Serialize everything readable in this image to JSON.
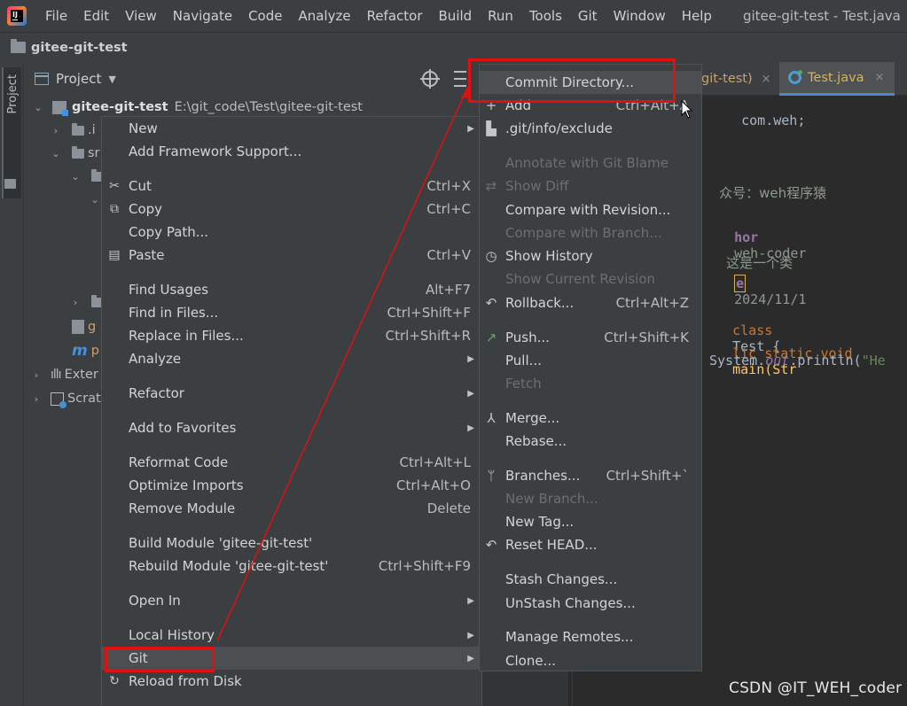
{
  "menubar": {
    "items": [
      "File",
      "Edit",
      "View",
      "Navigate",
      "Code",
      "Analyze",
      "Refactor",
      "Build",
      "Run",
      "Tools",
      "Git",
      "Window",
      "Help"
    ],
    "window_title": "gitee-git-test - Test.java"
  },
  "project_bar": {
    "name": "gitee-git-test"
  },
  "side_strip": {
    "tab_label": "Project"
  },
  "project_panel": {
    "view_label": "Project",
    "root": {
      "name": "gitee-git-test",
      "path": "E:\\git_code\\Test\\gitee-git-test"
    },
    "rows": [
      ".i",
      "sr",
      "g",
      "p",
      "Exter",
      "Scrat"
    ]
  },
  "editor": {
    "tabs": [
      {
        "label": "git-test)",
        "close": "×"
      },
      {
        "label": "Test.java",
        "close": "×"
      }
    ],
    "code": {
      "line1": "com.weh;",
      "line2": "众号：weh程序猿",
      "line3_tag": "hor",
      "line3_val": "weh-coder",
      "line4": "这是一个类",
      "line5_tag": "e",
      "line5_val": "2024/11/1",
      "line6_kw": "class",
      "line6_name": "Test {",
      "line7_kw": "lic static void",
      "line7_name": "main(Str",
      "line8_a": "System.",
      "line8_b": "out",
      "line8_c": ".println(",
      "line8_d": "\"He"
    }
  },
  "context_menu": {
    "items": [
      {
        "label": "New",
        "shortcut": "",
        "arrow": true
      },
      {
        "label": "Add Framework Support...",
        "shortcut": "",
        "arrow": false
      },
      {
        "label": "Cut",
        "shortcut": "Ctrl+X",
        "arrow": false,
        "icon": "cut-icon"
      },
      {
        "label": "Copy",
        "shortcut": "Ctrl+C",
        "arrow": false,
        "icon": "copy-icon"
      },
      {
        "label": "Copy Path...",
        "shortcut": "",
        "arrow": false
      },
      {
        "label": "Paste",
        "shortcut": "Ctrl+V",
        "arrow": false,
        "icon": "paste-icon"
      },
      {
        "label": "Find Usages",
        "shortcut": "Alt+F7",
        "arrow": false
      },
      {
        "label": "Find in Files...",
        "shortcut": "Ctrl+Shift+F",
        "arrow": false
      },
      {
        "label": "Replace in Files...",
        "shortcut": "Ctrl+Shift+R",
        "arrow": false
      },
      {
        "label": "Analyze",
        "shortcut": "",
        "arrow": true
      },
      {
        "label": "Refactor",
        "shortcut": "",
        "arrow": true
      },
      {
        "label": "Add to Favorites",
        "shortcut": "",
        "arrow": true
      },
      {
        "label": "Reformat Code",
        "shortcut": "Ctrl+Alt+L",
        "arrow": false
      },
      {
        "label": "Optimize Imports",
        "shortcut": "Ctrl+Alt+O",
        "arrow": false
      },
      {
        "label": "Remove Module",
        "shortcut": "Delete",
        "arrow": false
      },
      {
        "label": "Build Module 'gitee-git-test'",
        "shortcut": "",
        "arrow": false
      },
      {
        "label": "Rebuild Module 'gitee-git-test'",
        "shortcut": "Ctrl+Shift+F9",
        "arrow": false
      },
      {
        "label": "Open In",
        "shortcut": "",
        "arrow": true
      },
      {
        "label": "Local History",
        "shortcut": "",
        "arrow": true
      },
      {
        "label": "Git",
        "shortcut": "",
        "arrow": true
      },
      {
        "label": "Reload from Disk",
        "shortcut": "",
        "arrow": false,
        "icon": "reload-icon"
      }
    ]
  },
  "git_menu": {
    "items": [
      {
        "label": "Commit Directory...",
        "shortcut": "",
        "enabled": true
      },
      {
        "label": "Add",
        "shortcut": "Ctrl+Alt+A",
        "enabled": true,
        "icon": "plus-icon"
      },
      {
        "label": ".git/info/exclude",
        "shortcut": "",
        "enabled": true,
        "icon": "file-icon"
      },
      {
        "label": "Annotate with Git Blame",
        "shortcut": "",
        "enabled": false
      },
      {
        "label": "Show Diff",
        "shortcut": "",
        "enabled": false,
        "icon": "diff-icon"
      },
      {
        "label": "Compare with Revision...",
        "shortcut": "",
        "enabled": true
      },
      {
        "label": "Compare with Branch...",
        "shortcut": "",
        "enabled": false
      },
      {
        "label": "Show History",
        "shortcut": "",
        "enabled": true,
        "icon": "clock-icon"
      },
      {
        "label": "Show Current Revision",
        "shortcut": "",
        "enabled": false
      },
      {
        "label": "Rollback...",
        "shortcut": "Ctrl+Alt+Z",
        "enabled": true,
        "icon": "rollback-icon"
      },
      {
        "label": "Push...",
        "shortcut": "Ctrl+Shift+K",
        "enabled": true,
        "icon": "push-icon"
      },
      {
        "label": "Pull...",
        "shortcut": "",
        "enabled": true
      },
      {
        "label": "Fetch",
        "shortcut": "",
        "enabled": false
      },
      {
        "label": "Merge...",
        "shortcut": "",
        "enabled": true,
        "icon": "merge-icon"
      },
      {
        "label": "Rebase...",
        "shortcut": "",
        "enabled": true
      },
      {
        "label": "Branches...",
        "shortcut": "Ctrl+Shift+`",
        "enabled": true,
        "icon": "branch-icon"
      },
      {
        "label": "New Branch...",
        "shortcut": "",
        "enabled": false
      },
      {
        "label": "New Tag...",
        "shortcut": "",
        "enabled": true
      },
      {
        "label": "Reset HEAD...",
        "shortcut": "",
        "enabled": true,
        "icon": "reset-icon"
      },
      {
        "label": "Stash Changes...",
        "shortcut": "",
        "enabled": true
      },
      {
        "label": "UnStash Changes...",
        "shortcut": "",
        "enabled": true
      },
      {
        "label": "Manage Remotes...",
        "shortcut": "",
        "enabled": true
      },
      {
        "label": "Clone...",
        "shortcut": "",
        "enabled": true
      }
    ]
  },
  "watermark": "CSDN @IT_WEH_coder",
  "colors": {
    "annotation": "#e01010",
    "accent": "#4a88c7"
  }
}
